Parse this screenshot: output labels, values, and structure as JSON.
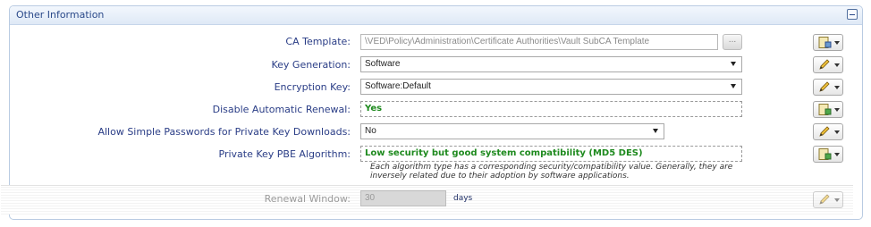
{
  "panel": {
    "title": "Other Information"
  },
  "fields": {
    "ca_template": {
      "label": "CA Template:",
      "value": "\\VED\\Policy\\Administration\\Certificate Authorities\\Vault SubCA Template",
      "browse_label": "..."
    },
    "key_generation": {
      "label": "Key Generation:",
      "value": "Software"
    },
    "encryption_key": {
      "label": "Encryption Key:",
      "value": "Software:Default"
    },
    "disable_renewal": {
      "label": "Disable Automatic Renewal:",
      "value": "Yes"
    },
    "simple_passwords": {
      "label": "Allow Simple Passwords for Private Key Downloads:",
      "value": "No"
    },
    "pbe_algorithm": {
      "label": "Private Key PBE Algorithm:",
      "value": "Low security but good system compatibility (MD5 DES)",
      "help": "Each algorithm type has a corresponding security/compatibility value. Generally, they are inversely related due to their adoption by software applications."
    },
    "renewal_window": {
      "label": "Renewal Window:",
      "value": "30",
      "unit": "days"
    }
  },
  "actions": [
    {
      "icon": "locked-policy-icon"
    },
    {
      "icon": "pencil-icon"
    },
    {
      "icon": "pencil-icon"
    },
    {
      "icon": "locked-policy-icon"
    },
    {
      "icon": "pencil-icon"
    },
    {
      "icon": "locked-policy-icon"
    },
    {
      "icon": "pencil-icon"
    }
  ],
  "colors": {
    "label": "#2a3d86",
    "locked_value": "#1e8a1e",
    "panel_border": "#b9cbe2"
  }
}
